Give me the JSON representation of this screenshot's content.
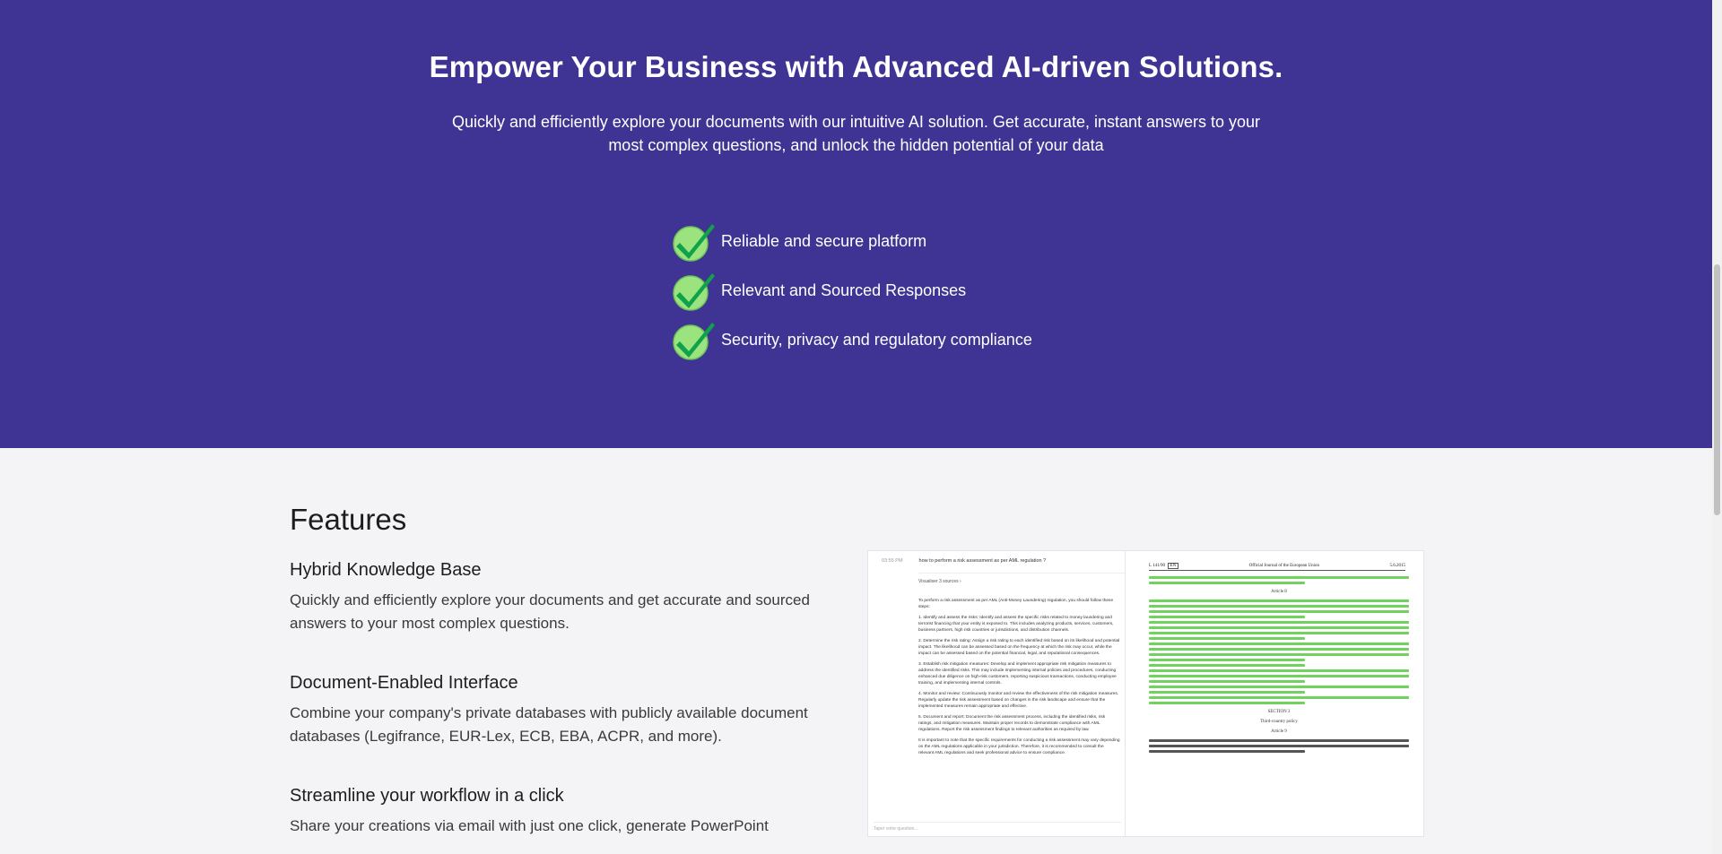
{
  "hero": {
    "title": "Empower Your Business with Advanced AI-driven Solutions.",
    "subtitle": "Quickly and efficiently explore your documents with our intuitive AI solution. Get accurate, instant answers to your most complex questions, and unlock the hidden potential of your data",
    "bullets": [
      {
        "icon": "check-icon",
        "label": "Reliable and secure platform"
      },
      {
        "icon": "check-icon",
        "label": "Relevant and Sourced Responses"
      },
      {
        "icon": "check-icon",
        "label": "Security, privacy and regulatory compliance"
      }
    ]
  },
  "features": {
    "title": "Features",
    "items": [
      {
        "title": "Hybrid Knowledge Base",
        "description": "Quickly and efficiently explore your documents and get accurate and sourced answers to your most complex questions."
      },
      {
        "title": "Document-Enabled Interface",
        "description": "Combine your company's private databases with publicly available document databases (Legifrance, EUR-Lex, ECB, EBA, ACPR, and more)."
      },
      {
        "title": "Streamline your workflow in a click",
        "description": "Share your creations via email with just one click, generate PowerPoint"
      }
    ]
  },
  "preview": {
    "chat_time": "03:55 PM",
    "chat_question": "how to perform a risk assessment as per AML regulation ?",
    "chat_tag": "Visualiser 3 sources",
    "answer_paragraphs": [
      "To perform a risk assessment as per AML (Anti-Money Laundering) regulation, you should follow these steps:",
      "1. Identify and assess the risks: Identify and assess the specific risks related to money laundering and terrorist financing that your entity is exposed to. This includes analyzing products, services, customers, business partners, high risk countries or jurisdictions, and distribution channels.",
      "2. Determine the risk rating: Assign a risk rating to each identified risk based on its likelihood and potential impact. The likelihood can be assessed based on the frequency at which the risk may occur, while the impact can be assessed based on the potential financial, legal, and reputational consequences.",
      "3. Establish risk mitigation measures: Develop and implement appropriate risk mitigation measures to address the identified risks. This may include implementing internal policies and procedures, conducting enhanced due diligence on high-risk customers, reporting suspicious transactions, conducting employee training, and implementing internal controls.",
      "4. Monitor and review: Continuously monitor and review the effectiveness of the risk mitigation measures. Regularly update the risk assessment based on changes in the risk landscape and ensure that the implemented measures remain appropriate and effective.",
      "5. Document and report: Document the risk assessment process, including the identified risks, risk ratings, and mitigation measures. Maintain proper records to demonstrate compliance with AML regulations. Report the risk assessment findings to relevant authorities as required by law.",
      "It is important to note that the specific requirements for conducting a risk assessment may vary depending on the AML regulations applicable in your jurisdiction. Therefore, it is recommended to consult the relevant AML regulations and seek professional advice to ensure compliance."
    ],
    "chat_placeholder": "Taper votre question...",
    "doc_left": "L 141/90",
    "doc_page": "EN",
    "doc_center": "Official Journal of the European Union",
    "doc_date": "5.6.2015",
    "doc_article": "Article 8",
    "doc_section": "SECTION 3",
    "doc_section_title": "Third-country policy",
    "doc_article2": "Article 9"
  },
  "colors": {
    "hero_bg": "#3f3493",
    "check_fill": "#9be37f",
    "check_mark": "#10a24a"
  }
}
